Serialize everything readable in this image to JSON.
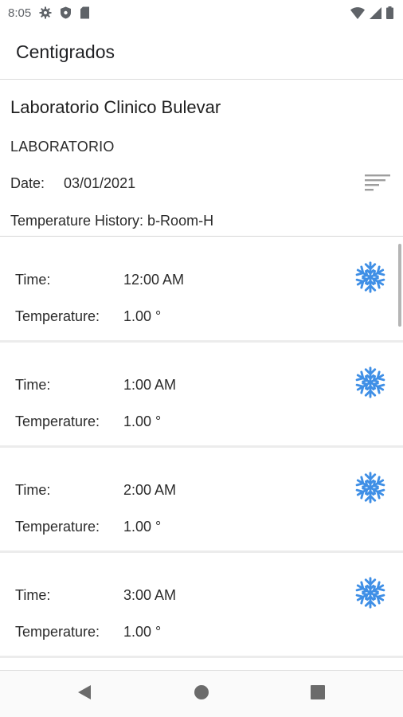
{
  "status_bar": {
    "time": "8:05",
    "icons": [
      "gear-icon",
      "shield-icon",
      "sd-card-icon",
      "wifi-icon",
      "signal-icon",
      "battery-icon"
    ]
  },
  "app_bar": {
    "title": "Centigrados"
  },
  "header": {
    "lab_name": "Laboratorio Clinico Bulevar",
    "lab_type": "LABORATORIO",
    "date_label": "Date:",
    "date_value": "03/01/2021",
    "history": "Temperature History: b-Room-H",
    "sort_icon": "sort-icon"
  },
  "records": [
    {
      "time_label": "Time:",
      "time": "12:00 AM",
      "temp_label": "Temperature:",
      "temp": "1.00 °",
      "icon": "snowflake-icon"
    },
    {
      "time_label": "Time:",
      "time": "1:00 AM",
      "temp_label": "Temperature:",
      "temp": "1.00 °",
      "icon": "snowflake-icon"
    },
    {
      "time_label": "Time:",
      "time": "2:00 AM",
      "temp_label": "Temperature:",
      "temp": "1.00 °",
      "icon": "snowflake-icon"
    },
    {
      "time_label": "Time:",
      "time": "3:00 AM",
      "temp_label": "Temperature:",
      "temp": "1.00 °",
      "icon": "snowflake-icon"
    }
  ],
  "colors": {
    "snowflake": "#3f8fe6",
    "icon_gray": "#5f6368",
    "divider": "#dcdcdc"
  },
  "nav_bar": {
    "icons": [
      "back-icon",
      "home-icon",
      "recents-icon"
    ]
  }
}
